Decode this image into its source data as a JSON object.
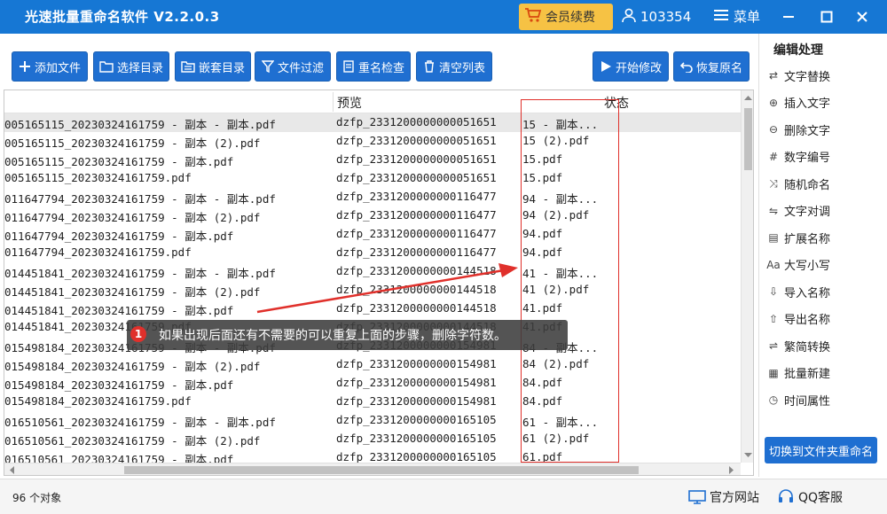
{
  "app": {
    "title": "光速批量重命名软件 V2.2.0.3",
    "vip_label": "会员续费",
    "user_id": "103354",
    "menu_label": "菜单",
    "accent": "#1677d4",
    "button_color": "#1f6fd1"
  },
  "toolbar": {
    "add_file": "添加文件",
    "choose_dir": "选择目录",
    "nested_dir": "嵌套目录",
    "file_filter": "文件过滤",
    "rename_check": "重名检查",
    "clear_list": "清空列表",
    "start_modify": "开始修改",
    "restore_name": "恢复原名"
  },
  "table": {
    "col_preview": "预览",
    "col_status": "状态",
    "rows": [
      {
        "orig": "005165115_20230324161759 - 副本 - 副本.pdf",
        "preview": "dzfp_2331200000000051651",
        "status": "15 - 副本..."
      },
      {
        "orig": "005165115_20230324161759 - 副本 (2).pdf",
        "preview": "dzfp_2331200000000051651",
        "status": "15 (2).pdf"
      },
      {
        "orig": "005165115_20230324161759 - 副本.pdf",
        "preview": "dzfp_2331200000000051651",
        "status": "15.pdf"
      },
      {
        "orig": "005165115_20230324161759.pdf",
        "preview": "dzfp_2331200000000051651",
        "status": "15.pdf"
      },
      {
        "orig": "011647794_20230324161759 - 副本 - 副本.pdf",
        "preview": "dzfp_2331200000000116477",
        "status": "94 - 副本..."
      },
      {
        "orig": "011647794_20230324161759 - 副本 (2).pdf",
        "preview": "dzfp_2331200000000116477",
        "status": "94 (2).pdf"
      },
      {
        "orig": "011647794_20230324161759 - 副本.pdf",
        "preview": "dzfp_2331200000000116477",
        "status": "94.pdf"
      },
      {
        "orig": "011647794_20230324161759.pdf",
        "preview": "dzfp_2331200000000116477",
        "status": "94.pdf"
      },
      {
        "orig": "014451841_20230324161759 - 副本 - 副本.pdf",
        "preview": "dzfp_2331200000000144518",
        "status": "41 - 副本..."
      },
      {
        "orig": "014451841_20230324161759 - 副本 (2).pdf",
        "preview": "dzfp_2331200000000144518",
        "status": "41 (2).pdf"
      },
      {
        "orig": "014451841_20230324161759 - 副本.pdf",
        "preview": "dzfp_2331200000000144518",
        "status": "41.pdf"
      },
      {
        "orig": "014451841_20230324161759.pdf",
        "preview": "dzfp_2331200000000144518",
        "status": "41.pdf"
      },
      {
        "orig": "015498184_20230324161759 - 副本 - 副本.pdf",
        "preview": "dzfp_2331200000000154981",
        "status": "84 - 副本..."
      },
      {
        "orig": "015498184_20230324161759 - 副本 (2).pdf",
        "preview": "dzfp_2331200000000154981",
        "status": "84 (2).pdf"
      },
      {
        "orig": "015498184_20230324161759 - 副本.pdf",
        "preview": "dzfp_2331200000000154981",
        "status": "84.pdf"
      },
      {
        "orig": "015498184_20230324161759.pdf",
        "preview": "dzfp_2331200000000154981",
        "status": "84.pdf"
      },
      {
        "orig": "016510561_20230324161759 - 副本 - 副本.pdf",
        "preview": "dzfp_2331200000000165105",
        "status": "61 - 副本..."
      },
      {
        "orig": "016510561_20230324161759 - 副本 (2).pdf",
        "preview": "dzfp_2331200000000165105",
        "status": "61 (2).pdf"
      },
      {
        "orig": "016510561_20230324161759 - 副本.pdf",
        "preview": "dzfp_2331200000000165105",
        "status": "61.pdf"
      }
    ]
  },
  "tip": {
    "number": "1",
    "text": "如果出现后面还有不需要的可以重复上面的步骤，删除字符数。"
  },
  "right_panel": {
    "title": "编辑处理",
    "items": [
      "文字替换",
      "插入文字",
      "删除文字",
      "数字编号",
      "随机命名",
      "文字对调",
      "扩展名称",
      "大写小写",
      "导入名称",
      "导出名称",
      "繁简转换",
      "批量新建",
      "时间属性"
    ],
    "switch_label": "切换到文件夹重命名"
  },
  "status": {
    "count": "96 个对象",
    "website": "官方网站",
    "qq": "QQ客服"
  }
}
